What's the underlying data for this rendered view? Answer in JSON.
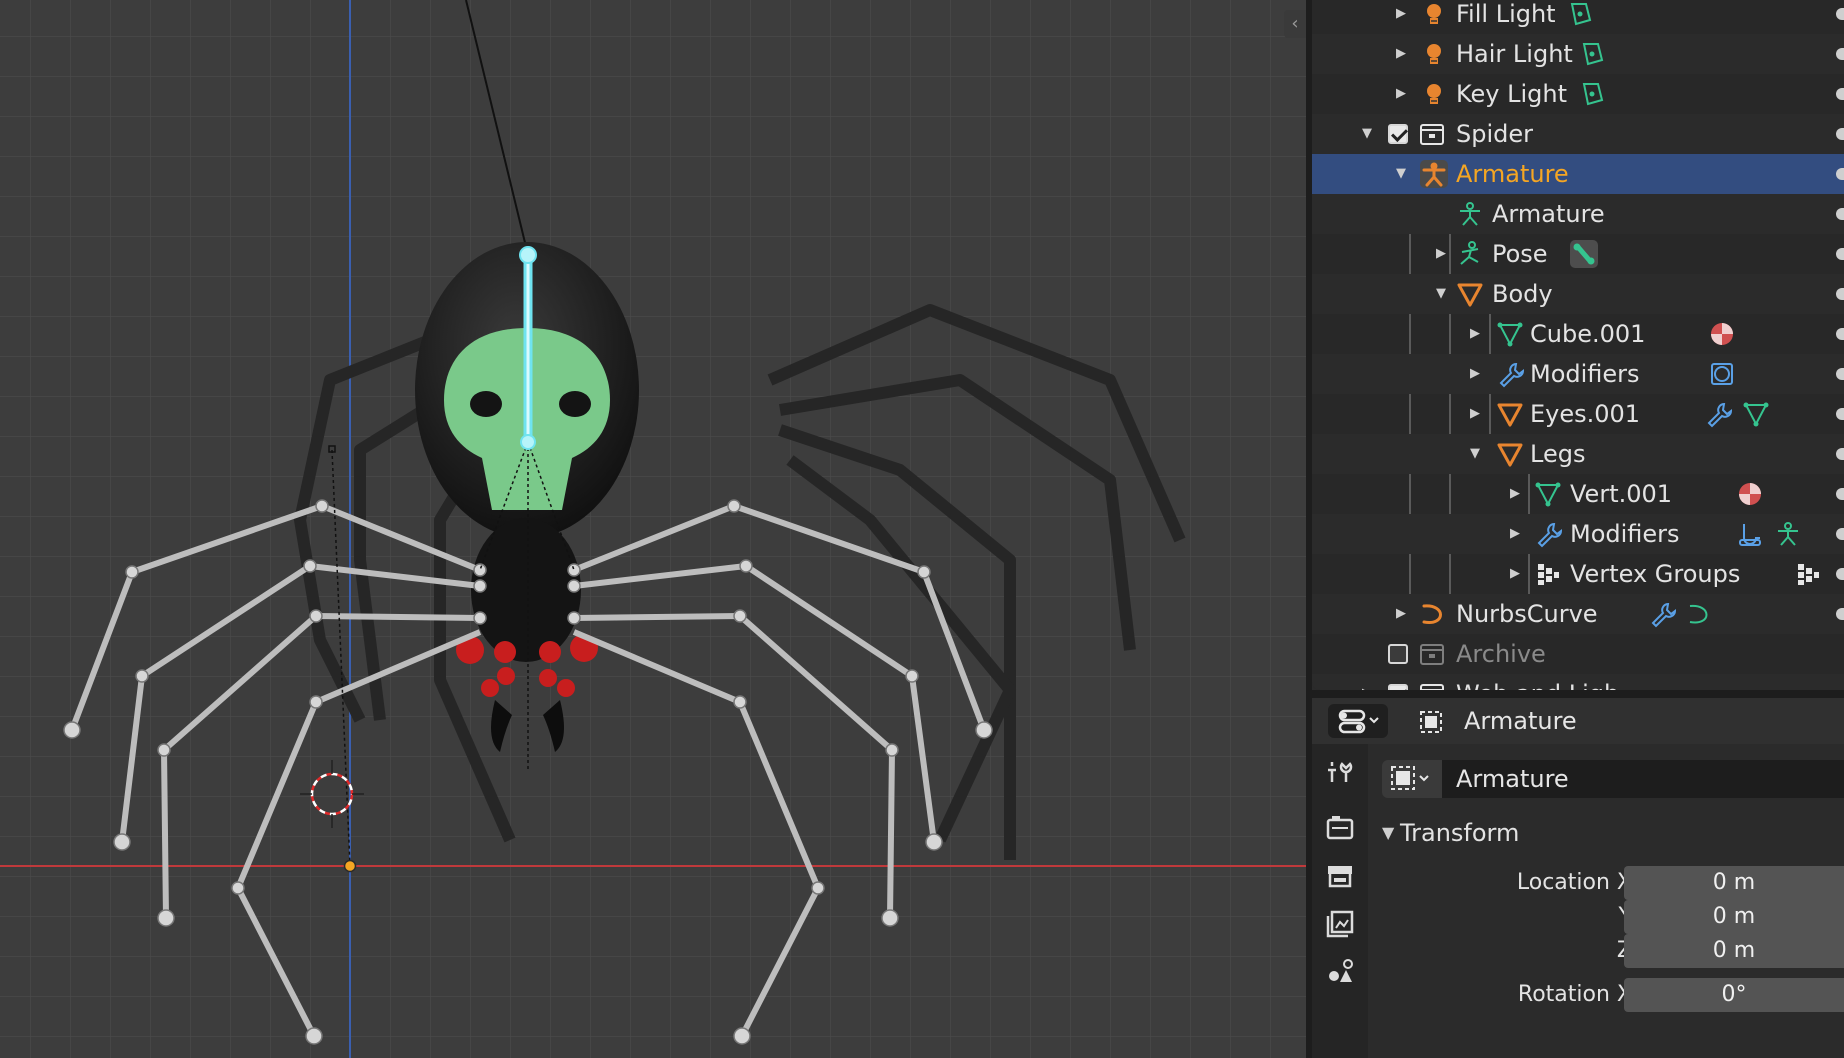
{
  "outliner": {
    "rows": [
      {
        "label": "Fill Light",
        "type": "light",
        "extra": "light-data-icon"
      },
      {
        "label": "Hair Light",
        "type": "light",
        "extra": "light-data-icon"
      },
      {
        "label": "Key Light",
        "type": "light",
        "extra": "light-data-icon"
      },
      {
        "label": "Spider",
        "type": "collection",
        "checked": true,
        "expanded": true
      },
      {
        "label": "Armature",
        "type": "armature-object",
        "selected": true,
        "expanded": true
      },
      {
        "label": "Armature",
        "type": "armature-data"
      },
      {
        "label": "Pose",
        "type": "pose",
        "extra": "bone-icon"
      },
      {
        "label": "Body",
        "type": "mesh-object",
        "expanded": true
      },
      {
        "label": "Cube.001",
        "type": "mesh-data",
        "extra": "material-icon"
      },
      {
        "label": "Modifiers",
        "type": "modifier",
        "extra": "subsurf-icon"
      },
      {
        "label": "Eyes.001",
        "type": "mesh-object",
        "extra": "wrench+mesh"
      },
      {
        "label": "Legs",
        "type": "mesh-object",
        "expanded": true
      },
      {
        "label": "Vert.001",
        "type": "mesh-data",
        "extra": "material-icon"
      },
      {
        "label": "Modifiers",
        "type": "modifier",
        "extra": "hook+armature"
      },
      {
        "label": "Vertex Groups",
        "type": "vertex-groups",
        "extra": "vertex-groups-icon"
      },
      {
        "label": "NurbsCurve",
        "type": "curve-object",
        "extra": "wrench+curve"
      },
      {
        "label": "Archive",
        "type": "collection",
        "checked": false,
        "dimmed": true
      },
      {
        "label": "Web and Ligh",
        "type": "collection",
        "checked": true,
        "clipped": true
      }
    ]
  },
  "properties": {
    "header_title": "Armature",
    "context_name": "Armature",
    "panel_title": "Transform",
    "fields": [
      {
        "label": "Location X",
        "value": "0 m"
      },
      {
        "label": "Y",
        "value": "0 m"
      },
      {
        "label": "Z",
        "value": "0 m"
      },
      {
        "label": "Rotation X",
        "value": "0°"
      }
    ]
  },
  "colors": {
    "selection": "#334d80",
    "active_text": "#f5a623",
    "object_orange": "#e8852f",
    "data_green": "#35c48f",
    "viewport_bg": "#3d3d3d",
    "x_axis": "#c0393b",
    "z_axis": "#3a5fb0",
    "active_bone": "#6fe3f0"
  }
}
